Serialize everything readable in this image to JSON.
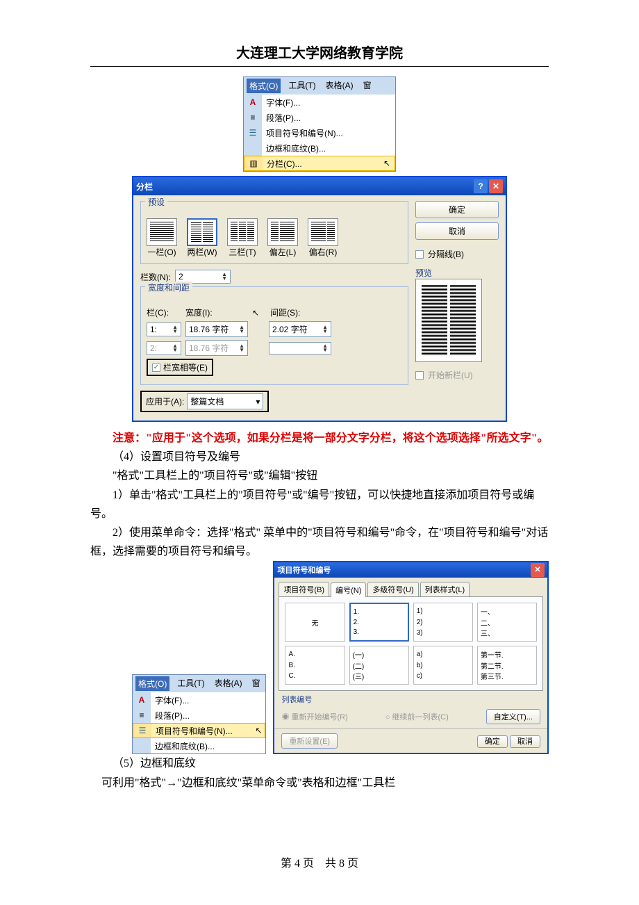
{
  "header": {
    "title": "大连理工大学网络教育学院"
  },
  "menu1": {
    "bar": [
      "格式(O)",
      "工具(T)",
      "表格(A)",
      "窗"
    ],
    "items": [
      "字体(F)...",
      "段落(P)...",
      "项目符号和编号(N)...",
      "边框和底纹(B)...",
      "分栏(C)..."
    ]
  },
  "columnsDialog": {
    "title": "分栏",
    "presetLegend": "预设",
    "presets": [
      "一栏(O)",
      "两栏(W)",
      "三栏(T)",
      "偏左(L)",
      "偏右(R)"
    ],
    "ok": "确定",
    "cancel": "取消",
    "separator": "分隔线(B)",
    "colCountLabel": "栏数(N):",
    "colCountValue": "2",
    "widthSpacingLegend": "宽度和间距",
    "colLabel": "栏(C):",
    "widthLabel": "宽度(I):",
    "spacingLabel": "间距(S):",
    "row1": {
      "col": "1:",
      "width": "18.76 字符",
      "spacing": "2.02 字符"
    },
    "row2": {
      "col": "2:",
      "width": "18.76 字符",
      "spacing": ""
    },
    "equal": "栏宽相等(E)",
    "applyToLabel": "应用于(A):",
    "applyToValue": "整篇文档",
    "previewLegend": "预览",
    "newCol": "开始新栏(U)"
  },
  "text": {
    "warn": "注意：\"应用于\"这个选项，如果分栏是将一部分文字分栏，将这个选项选择\"所选文字\"。",
    "p4": "（4）设置项目符号及编号",
    "p4a": "\"格式\"工具栏上的\"项目符号\"或\"编辑\"按钮",
    "p4b": "1）单击\"格式\"工具栏上的\"项目符号\"或\"编号\"按钮，可以快捷地直接添加项目符号或编号。",
    "p4c": "2）使用菜单命令：选择\"格式\" 菜单中的\"项目符号和编号\"命令，在\"项目符号和编号\"对话框，选择需要的项目符号和编号。",
    "p5": "（5）边框和底纹",
    "p5a": "可利用\"格式\"→\"边框和底纹\"菜单命令或\"表格和边框\"工具栏"
  },
  "menu2": {
    "bar": [
      "格式(O)",
      "工具(T)",
      "表格(A)",
      "窗"
    ],
    "items": [
      "字体(F)...",
      "段落(P)...",
      "项目符号和编号(N)...",
      "边框和底纹(B)..."
    ]
  },
  "bhDialog": {
    "title": "项目符号和编号",
    "tabs": [
      "项目符号(B)",
      "编号(N)",
      "多级符号(U)",
      "列表样式(L)"
    ],
    "none": "无",
    "cells": [
      [
        "1.",
        "2.",
        "3."
      ],
      [
        "1)",
        "2)",
        "3)"
      ],
      [
        "一、",
        "二、",
        "三、"
      ],
      [
        "A.",
        "B.",
        "C."
      ],
      [
        "(一)",
        "(二)",
        "(三)"
      ],
      [
        "a)",
        "b)",
        "c)"
      ],
      [
        "第一节.",
        "第二节.",
        "第三节."
      ]
    ],
    "listNum": "列表编号",
    "restart": "重新开始编号(R)",
    "continue": "继续前一列表(C)",
    "custom": "自定义(T)...",
    "reset": "重新设置(E)",
    "ok": "确定",
    "cancel": "取消"
  },
  "footer": {
    "page": "第 4 页",
    "total": "共 8 页"
  }
}
